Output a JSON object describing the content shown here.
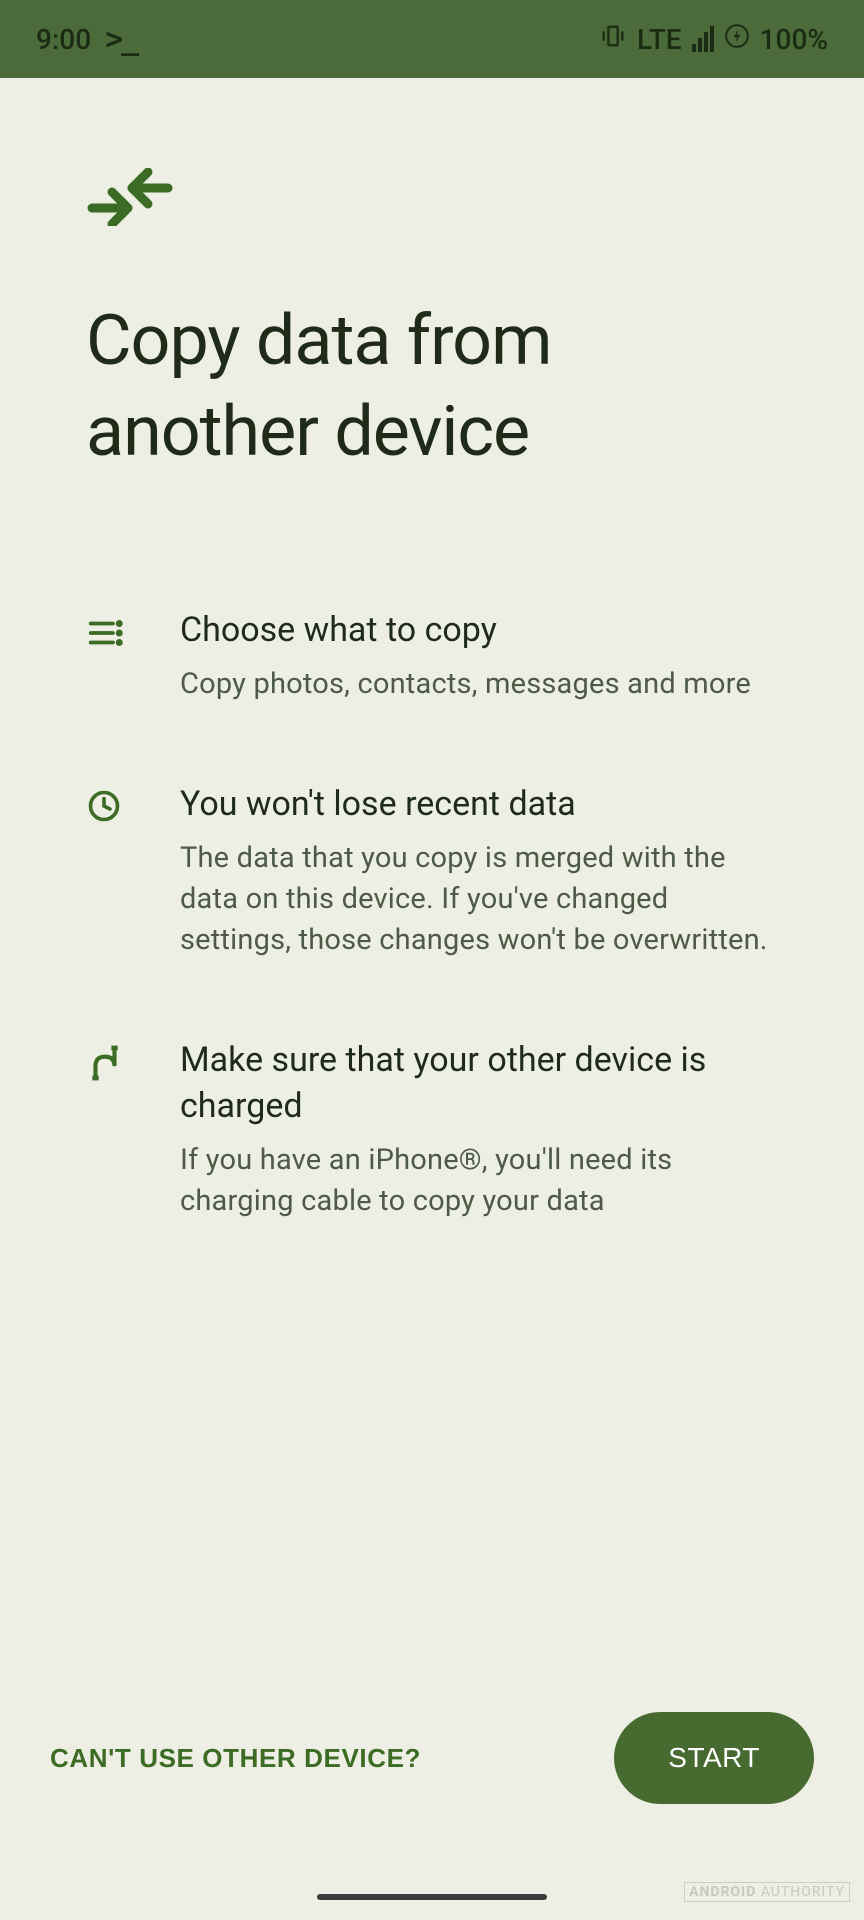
{
  "status": {
    "time": "9:00",
    "net_label": "LTE",
    "battery": "100%"
  },
  "header": {
    "title": "Copy data from another device"
  },
  "items": [
    {
      "title": "Choose what to copy",
      "desc": "Copy photos, contacts, messages and more"
    },
    {
      "title": "You won't lose recent data",
      "desc": "The data that you copy is merged with the data on this device. If you've changed settings, those changes won't be overwritten."
    },
    {
      "title": "Make sure that your other device is charged",
      "desc": "If you have an iPhone®, you'll need its charging cable to copy your data"
    }
  ],
  "footer": {
    "secondary": "CAN'T USE OTHER DEVICE?",
    "primary": "START"
  },
  "watermark": "ANDROID AUTHORITY",
  "colors": {
    "accent": "#3c6b23",
    "primary_button": "#476a31",
    "bg": "#edefe4"
  }
}
